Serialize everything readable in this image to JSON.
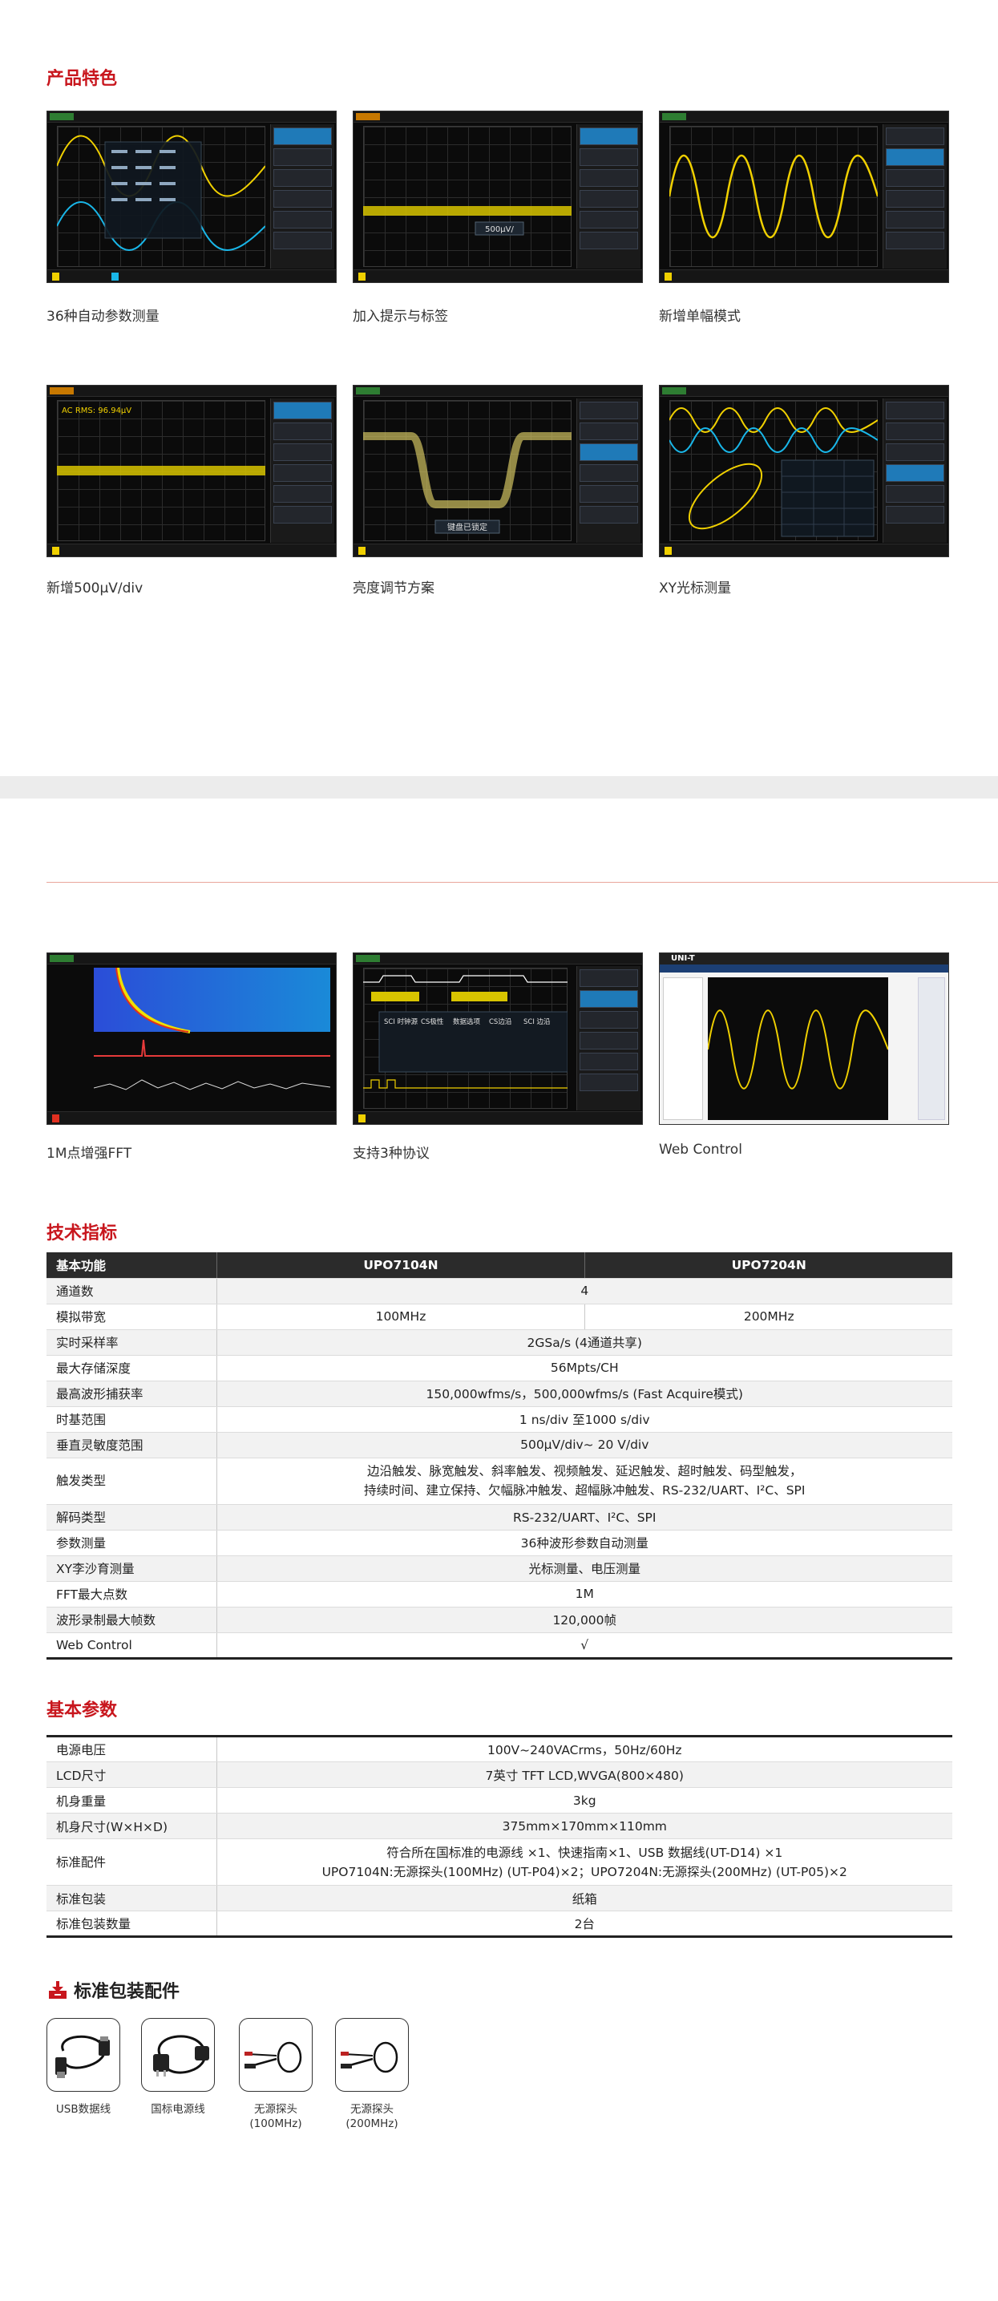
{
  "features": {
    "title": "产品特色",
    "items": [
      {
        "caption": "36种自动参数测量"
      },
      {
        "caption": "加入提示与标签"
      },
      {
        "caption": "新增单幅模式"
      },
      {
        "caption": "新增500μV/div"
      },
      {
        "caption": "亮度调节方案"
      },
      {
        "caption": "XY光标测量"
      },
      {
        "caption": "1M点增强FFT"
      },
      {
        "caption": "支持3种协议"
      },
      {
        "caption": "Web Control"
      }
    ],
    "screen_labels": {
      "trig": "TRIGD",
      "auto": "AUTO",
      "brand": "UNI-T",
      "tip_500uv": "500μV/",
      "ac_rms": "AC RMS: 96.94μV",
      "key_lock": "键盘已锁定",
      "protocols": [
        "SCI 时钟源",
        "CS极性",
        "数据选项",
        "CS边沿",
        "SCI 边沿"
      ]
    }
  },
  "specs": {
    "title": "技术指标",
    "headers": [
      "基本功能",
      "UPO7104N",
      "UPO7204N"
    ],
    "rows": [
      {
        "k": "通道数",
        "v": "4"
      },
      {
        "k": "模拟带宽",
        "v1": "100MHz",
        "v2": "200MHz"
      },
      {
        "k": "实时采样率",
        "v": "2GSa/s (4通道共享)"
      },
      {
        "k": "最大存储深度",
        "v": "56Mpts/CH"
      },
      {
        "k": "最高波形捕获率",
        "v": "150,000wfms/s，500,000wfms/s (Fast Acquire模式)"
      },
      {
        "k": "时基范围",
        "v": "1 ns/div 至1000 s/div"
      },
      {
        "k": "垂直灵敏度范围",
        "v": "500μV/div~ 20 V/div"
      },
      {
        "k": "触发类型",
        "v": "边沿触发、脉宽触发、斜率触发、视频触发、延迟触发、超时触发、码型触发，",
        "v_line2": "持续时间、建立保持、欠幅脉冲触发、超幅脉冲触发、RS-232/UART、I²C、SPI"
      },
      {
        "k": "解码类型",
        "v": "RS-232/UART、I²C、SPI"
      },
      {
        "k": "参数测量",
        "v": "36种波形参数自动测量"
      },
      {
        "k": "XY李沙育测量",
        "v": "光标测量、电压测量"
      },
      {
        "k": "FFT最大点数",
        "v": "1M"
      },
      {
        "k": "波形录制最大帧数",
        "v": "120,000帧"
      },
      {
        "k": "Web Control",
        "v": "√"
      }
    ]
  },
  "basic": {
    "title": "基本参数",
    "rows": [
      {
        "k": "电源电压",
        "v": "100V~240VACrms，50Hz/60Hz"
      },
      {
        "k": "LCD尺寸",
        "v": "7英寸 TFT LCD,WVGA(800×480)"
      },
      {
        "k": "机身重量",
        "v": "3kg"
      },
      {
        "k": "机身尺寸(W×H×D)",
        "v": "375mm×170mm×110mm"
      },
      {
        "k": "标准配件",
        "v": "符合所在国标准的电源线 ×1、快速指南×1、USB 数据线(UT-D14) ×1",
        "v_line2": "UPO7104N:无源探头(100MHz) (UT-P04)×2；UPO7204N:无源探头(200MHz) (UT-P05)×2"
      },
      {
        "k": "标准包装",
        "v": "纸箱"
      },
      {
        "k": "标准包装数量",
        "v": "2台"
      }
    ]
  },
  "package": {
    "title": "标准包装配件",
    "items": [
      {
        "label": "USB数据线",
        "icon": "usb-cable-icon"
      },
      {
        "label": "国标电源线",
        "icon": "power-cord-icon"
      },
      {
        "label": "无源探头",
        "label2": "(100MHz)",
        "icon": "probe-icon"
      },
      {
        "label": "无源探头",
        "label2": "(200MHz)",
        "icon": "probe-icon"
      }
    ]
  },
  "colors": {
    "accent": "#c8161d",
    "header_bg": "#2b2b2b",
    "trace_yellow": "#f0d000",
    "trace_cyan": "#19b6e8"
  }
}
